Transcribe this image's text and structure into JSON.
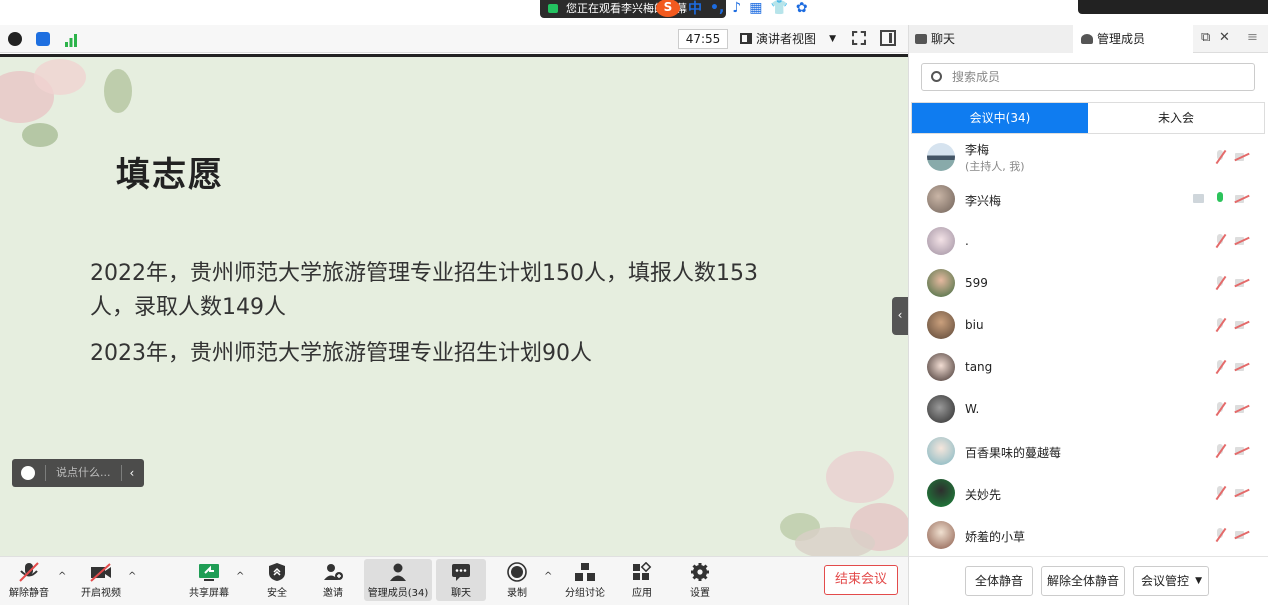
{
  "banner": {
    "watching": "您正在观看李兴梅的屏幕"
  },
  "ime": {
    "logo": "S",
    "items": [
      "中",
      "•,",
      "♪",
      "▦",
      "👕",
      "✿"
    ]
  },
  "toolbar": {
    "timer": "47:55",
    "view_label": "演讲者视图"
  },
  "slide": {
    "title": "填志愿",
    "line1": "2022年，贵州师范大学旅游管理专业招生计划150人，填报人数153",
    "line1b": "人，录取人数149人",
    "line2": "2023年，贵州师范大学旅游管理专业招生计划90人"
  },
  "chat_input": {
    "placeholder": "说点什么..."
  },
  "bottom": {
    "unmute": "解除静音",
    "video": "开启视频",
    "share": "共享屏幕",
    "security": "安全",
    "invite": "邀请",
    "members": "管理成员(34)",
    "chat": "聊天",
    "record": "录制",
    "breakout": "分组讨论",
    "apps": "应用",
    "settings": "设置",
    "end": "结束会议"
  },
  "panel": {
    "tab_chat": "聊天",
    "tab_members": "管理成员",
    "search_placeholder": "搜索成员",
    "in_meeting": "会议中(34)",
    "not_joined": "未入会",
    "members": [
      {
        "name": "李梅",
        "sub": "(主持人, 我)"
      },
      {
        "name": "李兴梅",
        "sub": ""
      },
      {
        "name": ".",
        "sub": ""
      },
      {
        "name": "599",
        "sub": ""
      },
      {
        "name": "biu",
        "sub": ""
      },
      {
        "name": "tang",
        "sub": ""
      },
      {
        "name": "W.",
        "sub": ""
      },
      {
        "name": "百香果味的蔓越莓",
        "sub": ""
      },
      {
        "name": "关妙先",
        "sub": ""
      },
      {
        "name": "娇羞的小草",
        "sub": ""
      }
    ],
    "mute_all": "全体静音",
    "unmute_all": "解除全体静音",
    "meeting_control": "会议管控"
  },
  "colors": {
    "accent": "#0f7cf0",
    "end": "#e34b4b",
    "slide_bg": "#e6eedf"
  }
}
